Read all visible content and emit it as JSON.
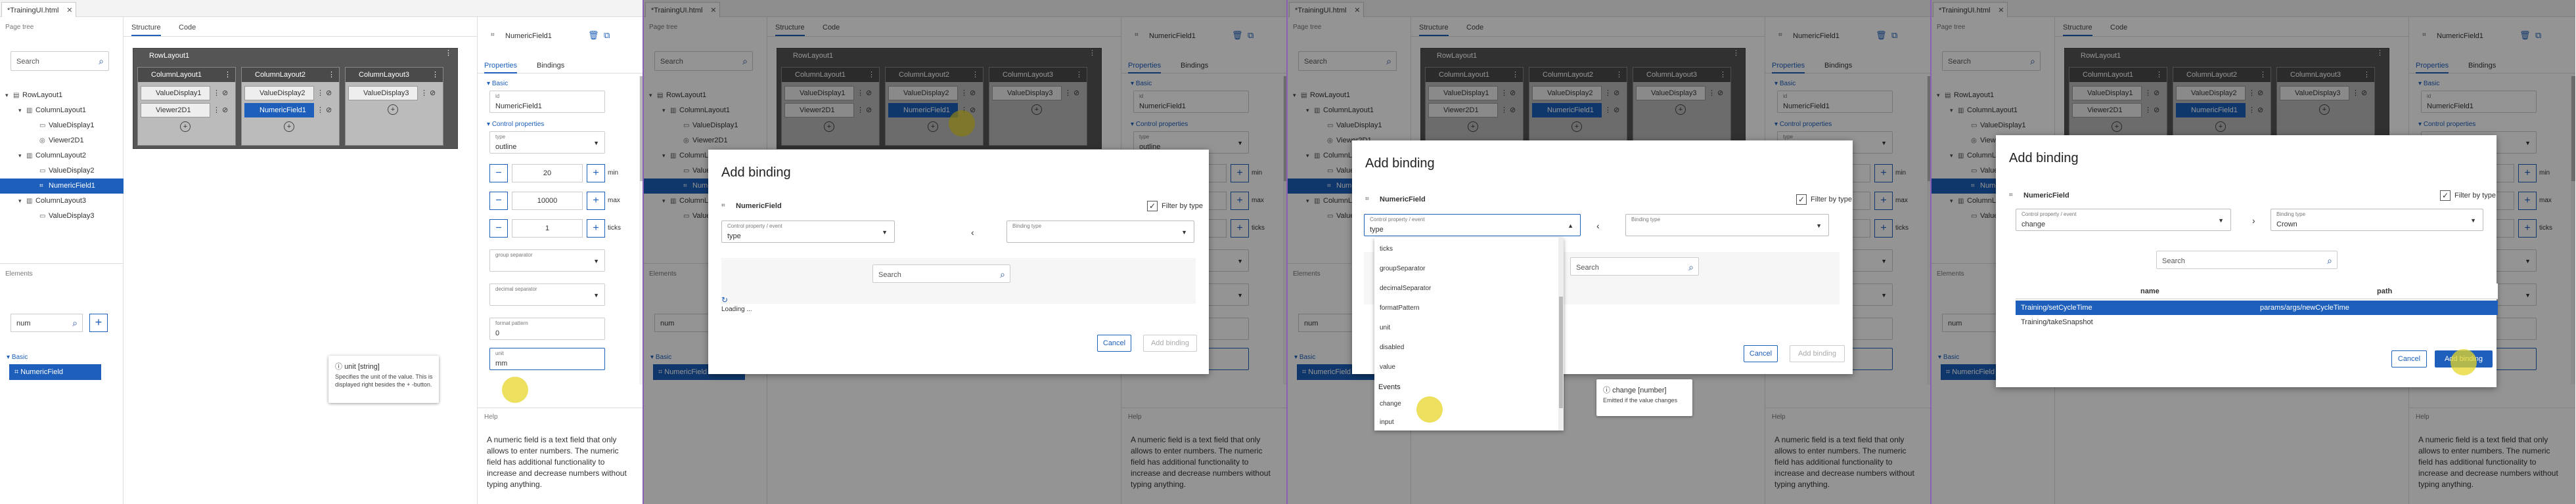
{
  "doc_tab": "*TrainingUI.html",
  "page_tree_title": "Page tree",
  "search_placeholder": "Search",
  "tree": [
    "RowLayout1",
    "ColumnLayout1",
    "ValueDisplay1",
    "Viewer2D1",
    "ColumnLayout2",
    "ValueDisplay2",
    "NumericField1",
    "ColumnLayout3",
    "ValueDisplay3"
  ],
  "elements_title": "Elements",
  "elements_search_value": "num",
  "elements_basic": "Basic",
  "elements_item": "NumericField",
  "structure_tab": "Structure",
  "code_tab": "Code",
  "row_layout": "RowLayout1",
  "columns": [
    "ColumnLayout1",
    "ColumnLayout2",
    "ColumnLayout3"
  ],
  "cells": {
    "c1": [
      "ValueDisplay1",
      "Viewer2D1"
    ],
    "c2": [
      "ValueDisplay2",
      "NumericField1"
    ],
    "c3": [
      "ValueDisplay3"
    ]
  },
  "props": {
    "title": "NumericField1",
    "tab_properties": "Properties",
    "tab_bindings": "Bindings",
    "basic": "Basic",
    "id_label": "id",
    "id_value": "NumericField1",
    "control_props": "Control properties",
    "type_label": "type",
    "type_value": "outline",
    "min_value": "20",
    "min_unit": "min",
    "max_value": "10000",
    "max_unit": "max",
    "step_value": "1",
    "step_unit": "ticks",
    "group_sep_label": "group separator",
    "decimal_sep_label": "decimal separator",
    "format_pattern_label": "format pattern",
    "format_pattern_value": "0",
    "unit_label": "unit",
    "unit_value": "mm",
    "help_title": "Help",
    "help_text": "A numeric field is a text field that only allows to enter numbers. The numeric field has additional functionality to increase and decrease numbers without typing anything."
  },
  "tooltip1": {
    "title": "unit [string]",
    "body": "Specifies the unit of the value. This is displayed right besides the + -button."
  },
  "dialog": {
    "title": "Add binding",
    "element": "NumericField",
    "filter": "Filter by type",
    "control_label": "Control property / event",
    "control_value_type": "type",
    "control_value_change": "change",
    "binding_type_label": "Binding type",
    "binding_type_value": "Crown",
    "search": "Search",
    "loading": "Loading ...",
    "cancel": "Cancel",
    "add": "Add binding"
  },
  "dropdown": {
    "items": [
      "ticks",
      "groupSeparator",
      "decimalSeparator",
      "formatPattern",
      "unit",
      "disabled",
      "value"
    ],
    "events_head": "Events",
    "events": [
      "change",
      "input"
    ]
  },
  "tooltip2": {
    "title": "change [number]",
    "body": "Emitted if the value changes"
  },
  "table": {
    "col_name": "name",
    "col_path": "path",
    "rows": [
      {
        "name": "Training/setCycleTime",
        "path": "params/args/newCycleTime"
      },
      {
        "name": "Training/takeSnapshot",
        "path": ""
      }
    ]
  }
}
